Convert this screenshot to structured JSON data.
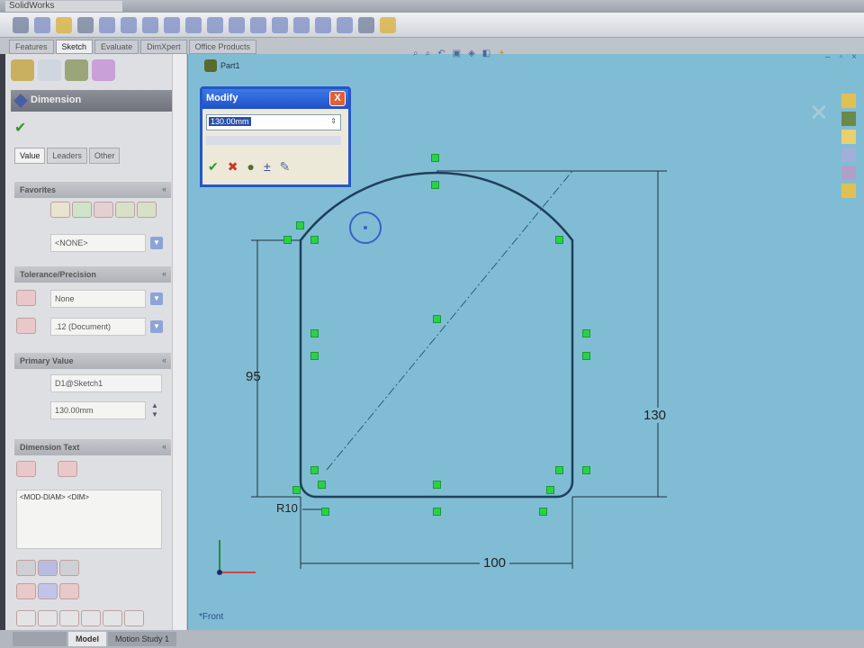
{
  "app": {
    "title": "SolidWorks"
  },
  "command_tabs": [
    "Features",
    "Sketch",
    "Evaluate",
    "DimXpert",
    "Office Products"
  ],
  "active_command_tab": "Sketch",
  "property_manager": {
    "title": "Dimension",
    "tabs": [
      "Value",
      "Leaders",
      "Other"
    ],
    "groups": {
      "favorites": {
        "label": "Favorites",
        "select": "<NONE>"
      },
      "tolerance": {
        "label": "Tolerance/Precision",
        "tolerance_type": "None",
        "precision": ".12 (Document)"
      },
      "primary_value": {
        "label": "Primary Value",
        "name": "D1@Sketch1",
        "value": "130.00mm"
      },
      "dimension_text": {
        "label": "Dimension Text",
        "text": "<MOD-DIAM> <DIM>"
      }
    }
  },
  "viewport": {
    "tree_item": "Part1",
    "view_label": "*Front",
    "modify_dialog": {
      "title": "Modify",
      "value": "130.00mm",
      "close": "X"
    },
    "dimensions": {
      "height_left": "95",
      "height_right": "130",
      "width": "100",
      "fillet": "R10"
    },
    "colors": {
      "background": "#80bdd4",
      "geometry": "#1f3f5a",
      "relation": "#2bd04a"
    }
  },
  "bottom_tabs": [
    "Model",
    "Motion Study 1"
  ],
  "active_bottom_tab": "Model"
}
